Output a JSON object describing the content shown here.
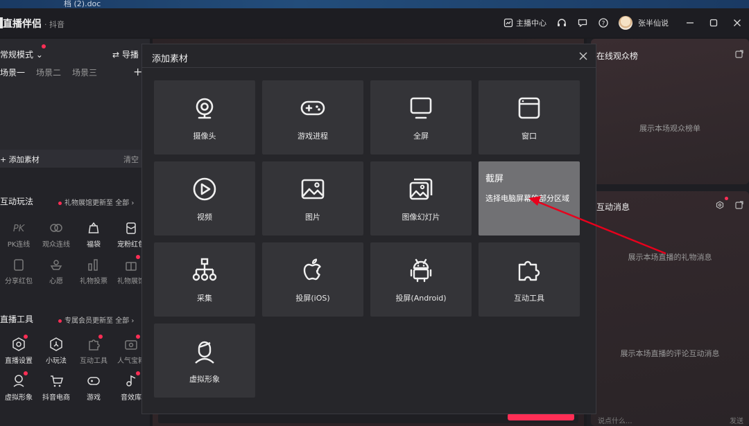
{
  "taskbar": {
    "tab_text": "档 (2).doc"
  },
  "titlebar": {
    "app_name": "直播伴侣",
    "platform": "· 抖音",
    "anchor_center": "主播中心",
    "username": "张半仙说"
  },
  "left": {
    "mode": "常规模式",
    "guide": "导播",
    "scenes": [
      "场景一",
      "场景二",
      "场景三"
    ],
    "add_source": "添加素材",
    "clear": "清空",
    "interact_title": "互动玩法",
    "interact_note": "礼物展馆更新至",
    "all_label": "全部",
    "interact_tools": [
      "PK连线",
      "观众连线",
      "福袋",
      "宠粉红包",
      "分享红包",
      "心愿",
      "礼物投票",
      "礼物展馆"
    ],
    "live_tools_title": "直播工具",
    "live_tools_note": "专属会员更新至",
    "live_tools": [
      "直播设置",
      "小玩法",
      "互动工具",
      "人气宝箱",
      "虚拟形象",
      "抖音电商",
      "游戏",
      "音效库"
    ]
  },
  "right": {
    "audience_title": "在线观众榜",
    "audience_empty": "展示本场观众榜单",
    "messages_title": "互动消息",
    "gift_empty": "展示本场直播的礼物消息",
    "comment_empty": "展示本场直播的评论互动消息",
    "input_placeholder": "说点什么...",
    "send": "发送"
  },
  "modal": {
    "title": "添加素材",
    "tiles": [
      {
        "label": "摄像头",
        "icon": "webcam-icon"
      },
      {
        "label": "游戏进程",
        "icon": "gamepad-icon"
      },
      {
        "label": "全屏",
        "icon": "monitor-icon"
      },
      {
        "label": "窗口",
        "icon": "window-icon"
      },
      {
        "label": "视频",
        "icon": "play-icon"
      },
      {
        "label": "图片",
        "icon": "image-icon"
      },
      {
        "label": "图像幻灯片",
        "icon": "slideshow-icon"
      },
      {
        "label": "截屏",
        "icon": "screenshot-icon",
        "hover_desc": "选择电脑屏幕的部分区域"
      },
      {
        "label": "采集",
        "icon": "capture-tree-icon"
      },
      {
        "label": "投屏(iOS)",
        "icon": "apple-icon"
      },
      {
        "label": "投屏(Android)",
        "icon": "android-icon"
      },
      {
        "label": "互动工具",
        "icon": "puzzle-icon"
      },
      {
        "label": "虚拟形象",
        "icon": "avatar-icon"
      }
    ]
  },
  "colors": {
    "accent": "#ff2e55",
    "annotation": "#e8001c"
  }
}
